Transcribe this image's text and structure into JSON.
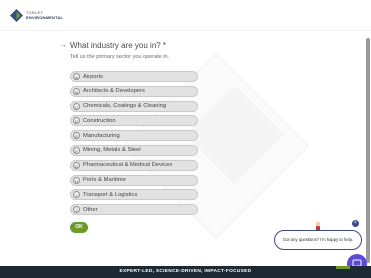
{
  "header": {
    "logo_line1": "TURLEY",
    "logo_line2": "ENVIRONMENTAL"
  },
  "question": {
    "title": "What industry are you in? *",
    "help": "Tell us the primary sector you operate in."
  },
  "options": [
    {
      "key": "A",
      "label": "Airports"
    },
    {
      "key": "B",
      "label": "Architects & Developers"
    },
    {
      "key": "C",
      "label": "Chemicals, Coatings & Cleaning"
    },
    {
      "key": "D",
      "label": "Construction"
    },
    {
      "key": "E",
      "label": "Manufacturing"
    },
    {
      "key": "F",
      "label": "Mining, Metals & Steel"
    },
    {
      "key": "G",
      "label": "Pharmaceutical & Medical Devices"
    },
    {
      "key": "H",
      "label": "Ports & Maritime"
    },
    {
      "key": "I",
      "label": "Transport & Logistics"
    },
    {
      "key": "J",
      "label": "Other"
    }
  ],
  "ok_label": "OK",
  "chat": {
    "bubble_text": "Got any questions? I'm happy to help."
  },
  "footer": {
    "text": "EXPERT-LED, SCIENCE-DRIVEN, IMPACT-FOCUSED"
  },
  "colors": {
    "accent_green": "#6f9a2a",
    "footer_bg": "#1d2a33",
    "chat_purple": "#5b4bd6",
    "navy": "#3b4a8a"
  }
}
